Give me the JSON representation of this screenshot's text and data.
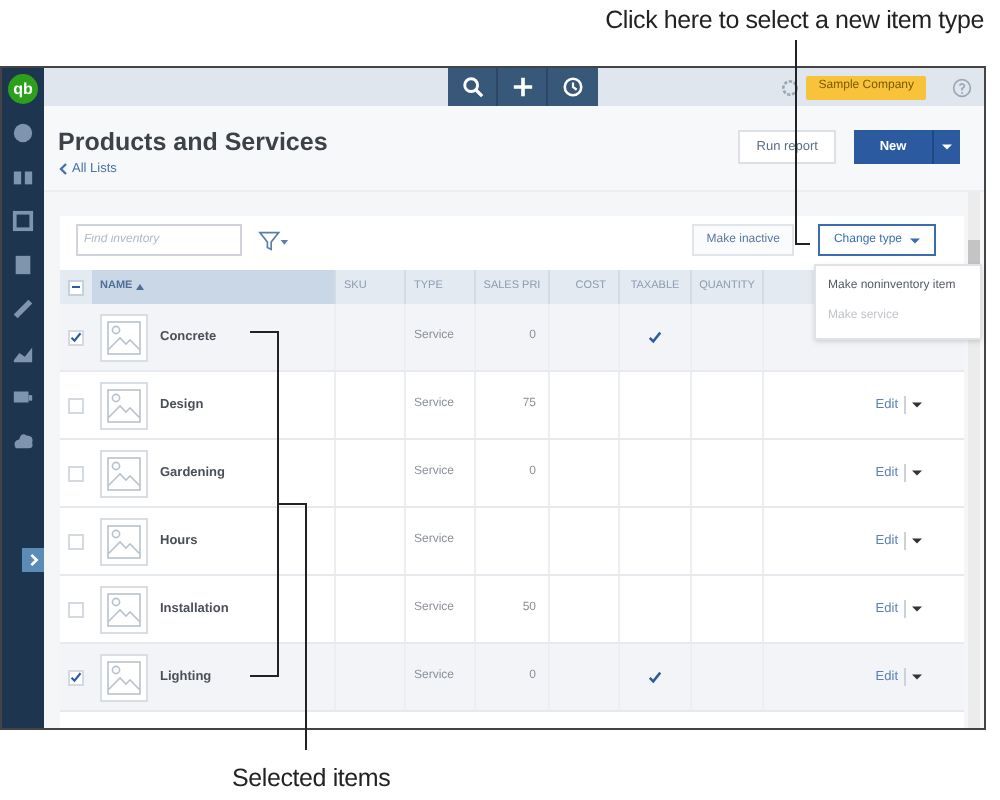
{
  "callouts": {
    "top": "Click here to select a new item type",
    "bottom": "Selected items"
  },
  "app": {
    "logo": "qb",
    "company": "Sample Company"
  },
  "page": {
    "title": "Products and Services",
    "back_link": "All Lists",
    "run_report": "Run report",
    "new_button": "New"
  },
  "toolbar": {
    "search_placeholder": "Find inventory",
    "make_inactive": "Make inactive",
    "change_type": "Change type"
  },
  "table": {
    "select_all_indeterminate": true,
    "columns": [
      {
        "label": "NAME",
        "sorted": true
      },
      {
        "label": "SKU",
        "sorted": false
      },
      {
        "label": "TYPE",
        "sorted": false
      },
      {
        "label": "SALES PRI",
        "sorted": false
      },
      {
        "label": "COST",
        "sorted": false
      },
      {
        "label": "TAXABLE",
        "sorted": false
      },
      {
        "label": "QUANTITY",
        "sorted": false
      }
    ],
    "rows": [
      {
        "selected": true,
        "name": "Concrete",
        "type": "Service",
        "sales_price": "0",
        "taxable": true
      },
      {
        "selected": false,
        "name": "Design",
        "type": "Service",
        "sales_price": "75",
        "taxable": false,
        "edit": "Edit"
      },
      {
        "selected": false,
        "name": "Gardening",
        "type": "Service",
        "sales_price": "0",
        "taxable": false,
        "edit": "Edit"
      },
      {
        "selected": false,
        "name": "Hours",
        "type": "Service",
        "taxable": false,
        "edit": "Edit"
      },
      {
        "selected": false,
        "name": "Installation",
        "type": "Service",
        "sales_price": "50",
        "taxable": false,
        "edit": "Edit"
      },
      {
        "selected": true,
        "name": "Lighting",
        "type": "Service",
        "sales_price": "0",
        "taxable": true,
        "edit": "Edit"
      }
    ]
  },
  "change_type_menu": [
    {
      "label": "Make noninventory item",
      "disabled": false
    },
    {
      "label": "Make service",
      "disabled": true
    }
  ]
}
